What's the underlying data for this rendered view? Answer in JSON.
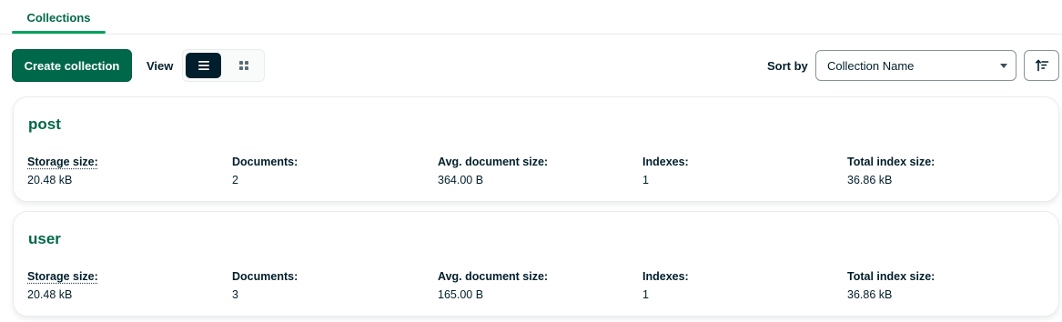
{
  "tabs": [
    {
      "label": "Collections",
      "active": true
    }
  ],
  "toolbar": {
    "create_label": "Create collection",
    "view_label": "View",
    "view_mode": "list",
    "sort_label": "Sort by",
    "sort_value": "Collection Name"
  },
  "stat_labels": {
    "storage": "Storage size:",
    "documents": "Documents:",
    "avg_size": "Avg. document size:",
    "indexes": "Indexes:",
    "total_index": "Total index size:"
  },
  "collections": [
    {
      "name": "post",
      "storage": "20.48 kB",
      "documents": "2",
      "avg_size": "364.00 B",
      "indexes": "1",
      "total_index": "36.86 kB"
    },
    {
      "name": "user",
      "storage": "20.48 kB",
      "documents": "3",
      "avg_size": "165.00 B",
      "indexes": "1",
      "total_index": "36.86 kB"
    }
  ],
  "colors": {
    "accent": "#00684a",
    "tab_underline": "#00a35c",
    "dark": "#001e2b"
  }
}
